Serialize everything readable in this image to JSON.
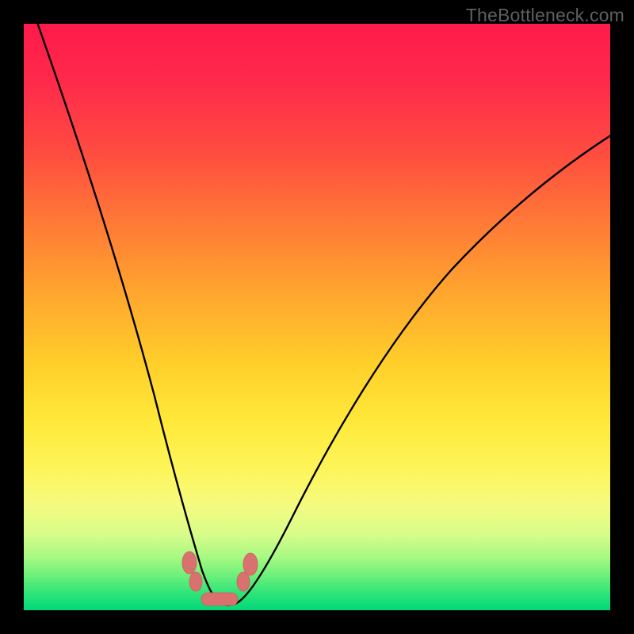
{
  "watermark": {
    "text": "TheBottleneck.com"
  },
  "chart_data": {
    "type": "line",
    "title": "",
    "xlabel": "",
    "ylabel": "",
    "xlim": [
      0,
      100
    ],
    "ylim": [
      0,
      100
    ],
    "legend": false,
    "grid": false,
    "background": "rainbow-gradient",
    "series": [
      {
        "name": "bottleneck-curve",
        "color": "#000000",
        "x": [
          0,
          4,
          8,
          12,
          15,
          18,
          20,
          22,
          24,
          26,
          28,
          30,
          31,
          32,
          33,
          34,
          35,
          37,
          40,
          45,
          50,
          55,
          60,
          66,
          72,
          78,
          85,
          92,
          100
        ],
        "values": [
          100,
          90,
          80,
          69,
          59,
          49,
          41,
          33,
          25,
          18,
          12,
          7,
          5,
          3,
          2,
          2,
          3,
          5,
          10,
          20,
          30,
          39,
          47,
          55,
          62,
          68,
          74,
          79,
          83
        ]
      },
      {
        "name": "valley-markers",
        "type": "scatter",
        "color": "#d9716e",
        "x": [
          27,
          29,
          31,
          33,
          36,
          38
        ],
        "values": [
          9,
          3,
          1,
          1,
          3,
          9
        ]
      }
    ],
    "annotations": []
  }
}
